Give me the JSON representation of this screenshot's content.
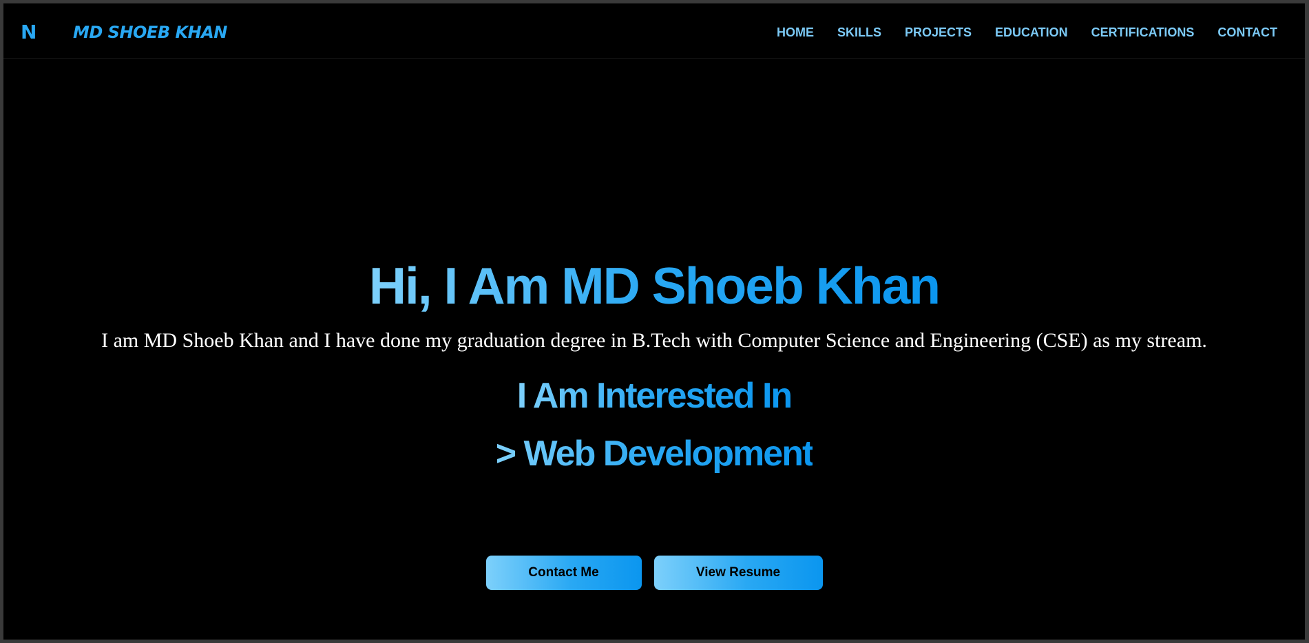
{
  "navbar": {
    "logo": "N",
    "brand": "MD SHOEB KHAN",
    "links": [
      "HOME",
      "SKILLS",
      "PROJECTS",
      "EDUCATION",
      "CERTIFICATIONS",
      "CONTACT"
    ]
  },
  "hero": {
    "title": "Hi, I Am MD Shoeb Khan",
    "description": "I am MD Shoeb Khan and I have done my graduation degree in B.Tech with Computer Science and Engineering (CSE) as my stream.",
    "interest_heading": "I Am Interested In",
    "interest_item": "> Web Development"
  },
  "buttons": {
    "contact": "Contact Me",
    "resume": "View Resume"
  },
  "colors": {
    "accent": "#29a8f3",
    "accent_light": "#7dd0fb",
    "nav_link": "#7ccaf6",
    "background": "#000000",
    "text": "#ffffff"
  }
}
